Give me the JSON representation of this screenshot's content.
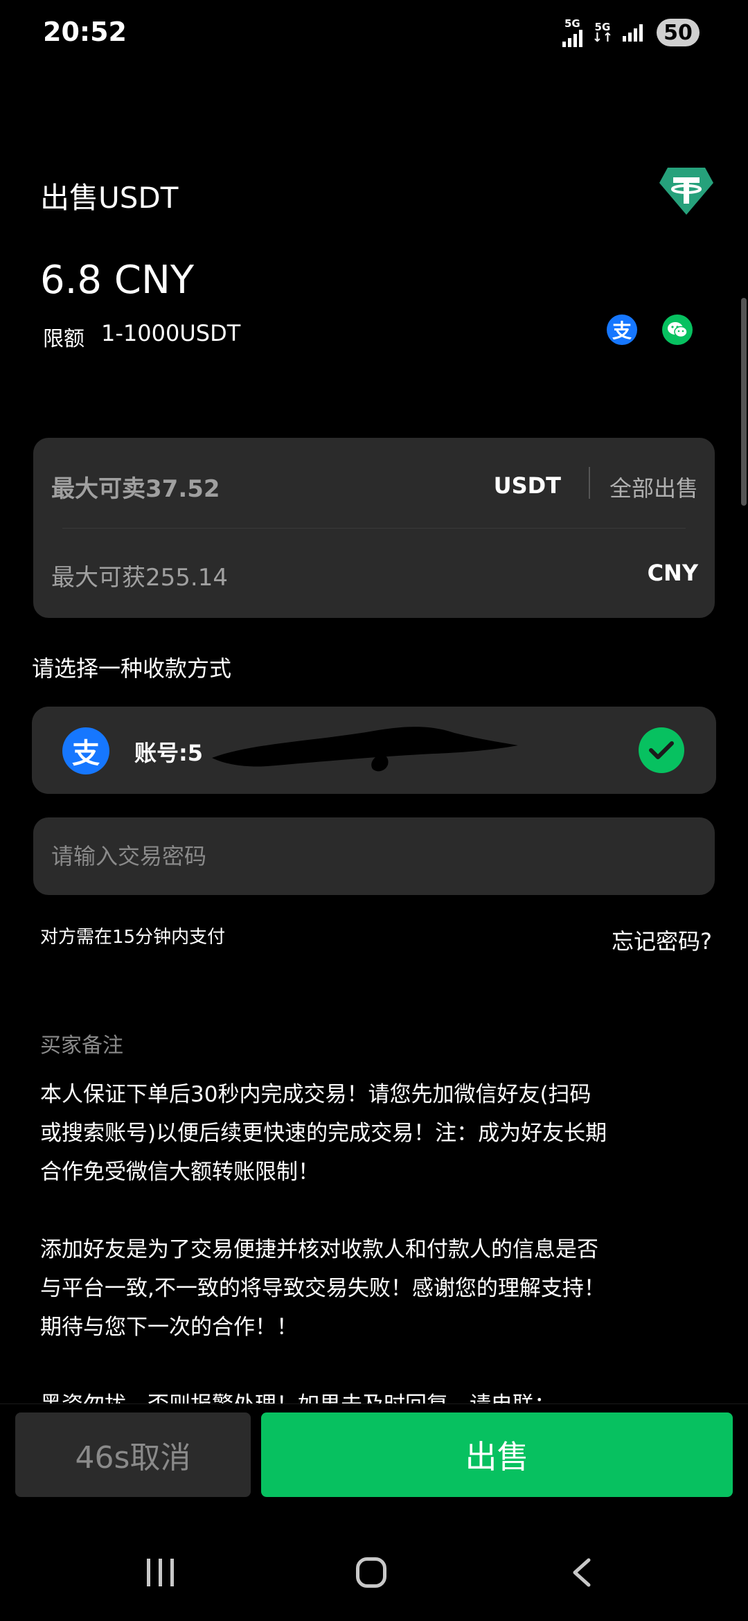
{
  "status_bar": {
    "time": "20:52",
    "net1": "5G",
    "net2": "5G",
    "battery": "50"
  },
  "header": {
    "title": "出售USDT",
    "price": "6.8 CNY",
    "limit_label": "限额",
    "limit_value": "1-1000USDT",
    "logo_icon": "tether-logo",
    "payment_icons": [
      "alipay-icon",
      "wechat-icon"
    ],
    "alipay_glyph": "支"
  },
  "amount_card": {
    "max_sell": "最大可卖37.52",
    "sell_unit": "USDT",
    "sell_all": "全部出售",
    "max_get": "最大可获255.14",
    "get_unit": "CNY"
  },
  "payment": {
    "section_label": "请选择一种收款方式",
    "method_glyph": "支",
    "account": "账号:5"
  },
  "password": {
    "placeholder": "请输入交易密码"
  },
  "notes": {
    "pay_within": "对方需在15分钟内支付",
    "forgot": "忘记密码?"
  },
  "remark": {
    "label": "买家备注",
    "paragraphs": [
      "本人保证下单后30秒内完成交易！请您先加微信好友(扫码或搜索账号)以便后续更快速的完成交易！注：成为好友长期合作免受微信大额转账限制！",
      "添加好友是为了交易便捷并核对收款人和付款人的信息是否与平台一致,不一致的将导致交易失败！感谢您的理解支持！期待与您下一次的合作！！",
      "黑资勿扰，否则报警处理！如果未及时回复，请电联："
    ]
  },
  "actions": {
    "cancel": "46s取消",
    "sell": "出售"
  },
  "colors": {
    "accent": "#07c160",
    "alipay": "#1677ff",
    "tether": "#26a17b",
    "card": "#2b2b2b"
  }
}
